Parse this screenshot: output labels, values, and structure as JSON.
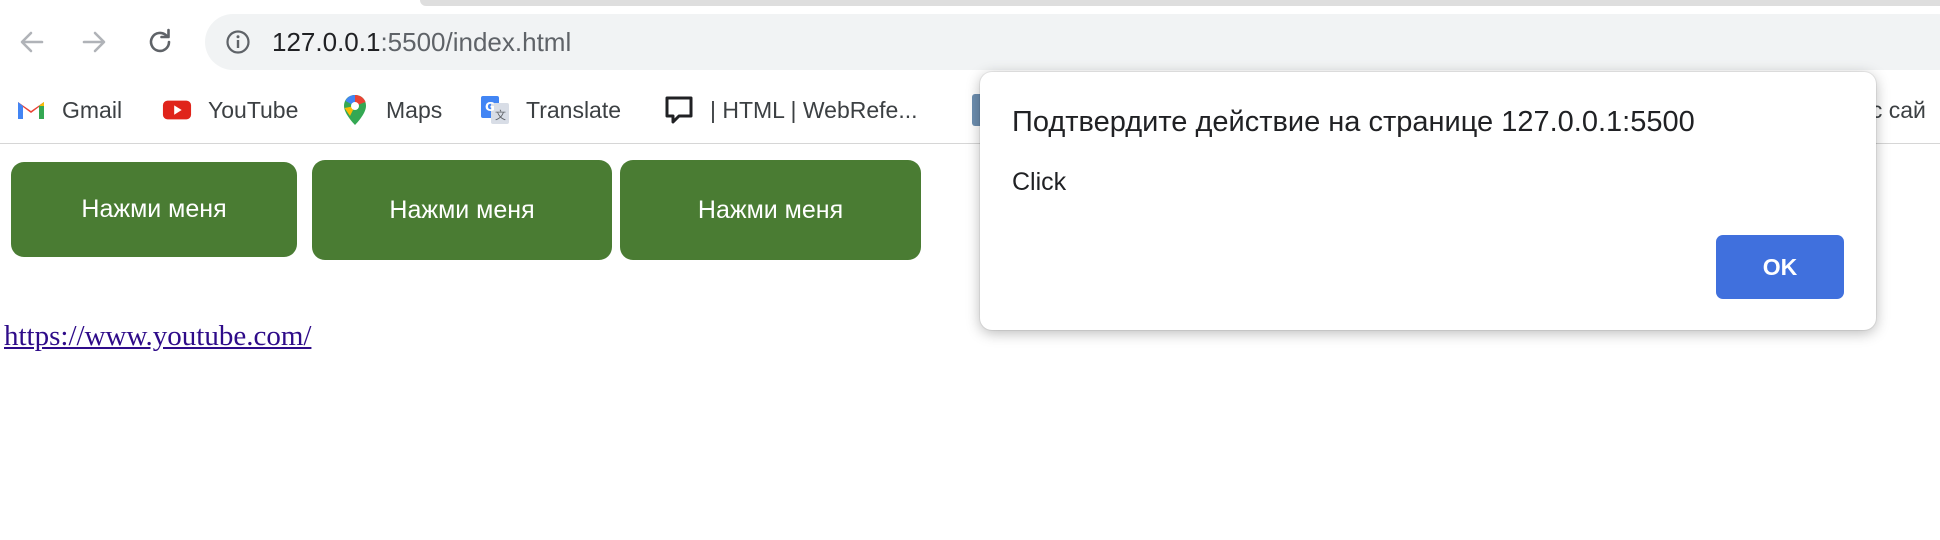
{
  "browser": {
    "url_host": "127.0.0.1",
    "url_rest": ":5500/index.html"
  },
  "bookmarks": [
    {
      "label": "Gmail",
      "icon": "gmail-icon"
    },
    {
      "label": "YouTube",
      "icon": "youtube-icon"
    },
    {
      "label": "Maps",
      "icon": "maps-icon"
    },
    {
      "label": "Translate",
      "icon": "translate-icon"
    },
    {
      "label": "| HTML | WebRefe...",
      "icon": "comment-icon"
    }
  ],
  "bookmarks_overflow_label": "ис сай",
  "page": {
    "buttons": [
      "Нажми меня",
      "Нажми меня",
      "Нажми меня"
    ],
    "link_text": "https://www.youtube.com/"
  },
  "dialog": {
    "title": "Подтвердите действие на странице 127.0.0.1:5500",
    "message": "Click",
    "ok_label": "OK"
  },
  "colors": {
    "button_green": "#4a7c33",
    "ok_blue": "#4070dd",
    "link_visited": "#2e0b89"
  }
}
